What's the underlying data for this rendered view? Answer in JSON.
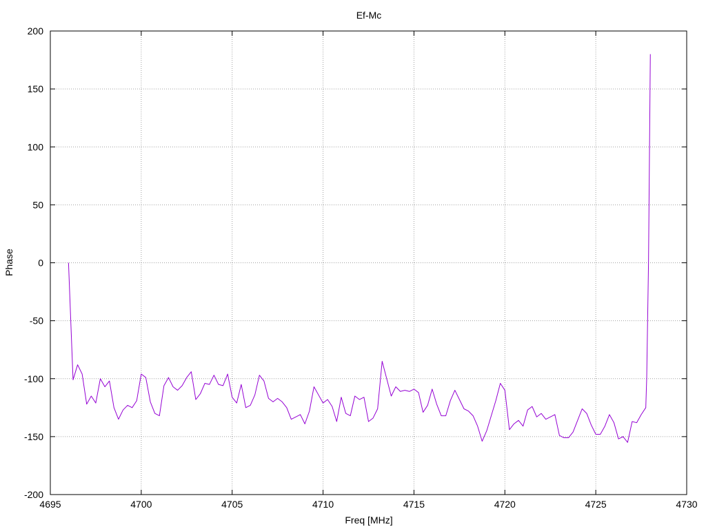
{
  "chart_data": {
    "type": "line",
    "title": "Ef-Mc",
    "xlabel": "Freq [MHz]",
    "ylabel": "Phase",
    "xlim": [
      4695,
      4730
    ],
    "ylim": [
      -200,
      200
    ],
    "xticks": [
      4695,
      4700,
      4705,
      4710,
      4715,
      4720,
      4725,
      4730
    ],
    "yticks": [
      -200,
      -150,
      -100,
      -50,
      0,
      50,
      100,
      150,
      200
    ],
    "grid": true,
    "legend": "none",
    "series": [
      {
        "color": "#9400d3",
        "x": [
          4696.0,
          4696.25,
          4696.5,
          4696.75,
          4697.0,
          4697.25,
          4697.5,
          4697.75,
          4698.0,
          4698.25,
          4698.5,
          4698.75,
          4699.0,
          4699.25,
          4699.5,
          4699.75,
          4700.0,
          4700.25,
          4700.5,
          4700.75,
          4701.0,
          4701.25,
          4701.5,
          4701.75,
          4702.0,
          4702.25,
          4702.5,
          4702.75,
          4703.0,
          4703.25,
          4703.5,
          4703.75,
          4704.0,
          4704.25,
          4704.5,
          4704.75,
          4705.0,
          4705.25,
          4705.5,
          4705.75,
          4706.0,
          4706.25,
          4706.5,
          4706.75,
          4707.0,
          4707.25,
          4707.5,
          4707.75,
          4708.0,
          4708.25,
          4708.5,
          4708.75,
          4709.0,
          4709.25,
          4709.5,
          4709.75,
          4710.0,
          4710.25,
          4710.5,
          4710.75,
          4711.0,
          4711.25,
          4711.5,
          4711.75,
          4712.0,
          4712.25,
          4712.5,
          4712.75,
          4713.0,
          4713.25,
          4713.5,
          4713.75,
          4714.0,
          4714.25,
          4714.5,
          4714.75,
          4715.0,
          4715.25,
          4715.5,
          4715.75,
          4716.0,
          4716.25,
          4716.5,
          4716.75,
          4717.0,
          4717.25,
          4717.5,
          4717.75,
          4718.0,
          4718.25,
          4718.5,
          4718.75,
          4719.0,
          4719.25,
          4719.5,
          4719.75,
          4720.0,
          4720.25,
          4720.5,
          4720.75,
          4721.0,
          4721.25,
          4721.5,
          4721.75,
          4722.0,
          4722.25,
          4722.5,
          4722.75,
          4723.0,
          4723.25,
          4723.5,
          4723.75,
          4724.0,
          4724.25,
          4724.5,
          4724.75,
          4725.0,
          4725.25,
          4725.5,
          4725.75,
          4726.0,
          4726.25,
          4726.5,
          4726.75,
          4727.0,
          4727.25,
          4727.5,
          4727.75,
          4727.8,
          4727.9,
          4728.0
        ],
        "y": [
          0,
          -101,
          -88,
          -96,
          -122,
          -115,
          -121,
          -100,
          -107,
          -102,
          -125,
          -135,
          -127,
          -123,
          -125,
          -119,
          -96,
          -99,
          -120,
          -130,
          -132,
          -106,
          -99,
          -107,
          -110,
          -106,
          -99,
          -94,
          -118,
          -113,
          -104,
          -105,
          -97,
          -105,
          -106,
          -96,
          -116,
          -121,
          -105,
          -125,
          -123,
          -114,
          -97,
          -102,
          -117,
          -120,
          -117,
          -120,
          -125,
          -135,
          -133,
          -131,
          -139,
          -128,
          -107,
          -114,
          -121,
          -118,
          -124,
          -137,
          -116,
          -130,
          -132,
          -115,
          -118,
          -116,
          -137,
          -134,
          -126,
          -85,
          -100,
          -115,
          -107,
          -111,
          -110,
          -111,
          -109,
          -112,
          -129,
          -123,
          -109,
          -122,
          -132,
          -132,
          -119,
          -110,
          -118,
          -126,
          -128,
          -132,
          -141,
          -154,
          -145,
          -132,
          -119,
          -104,
          -110,
          -144,
          -139,
          -136,
          -141,
          -127,
          -124,
          -133,
          -130,
          -135,
          -133,
          -131,
          -149,
          -151,
          -151,
          -146,
          -136,
          -126,
          -130,
          -140,
          -148,
          -148,
          -141,
          -131,
          -138,
          -152,
          -150,
          -155,
          -137,
          -138,
          -131,
          -125,
          -100,
          0,
          180
        ]
      }
    ]
  }
}
